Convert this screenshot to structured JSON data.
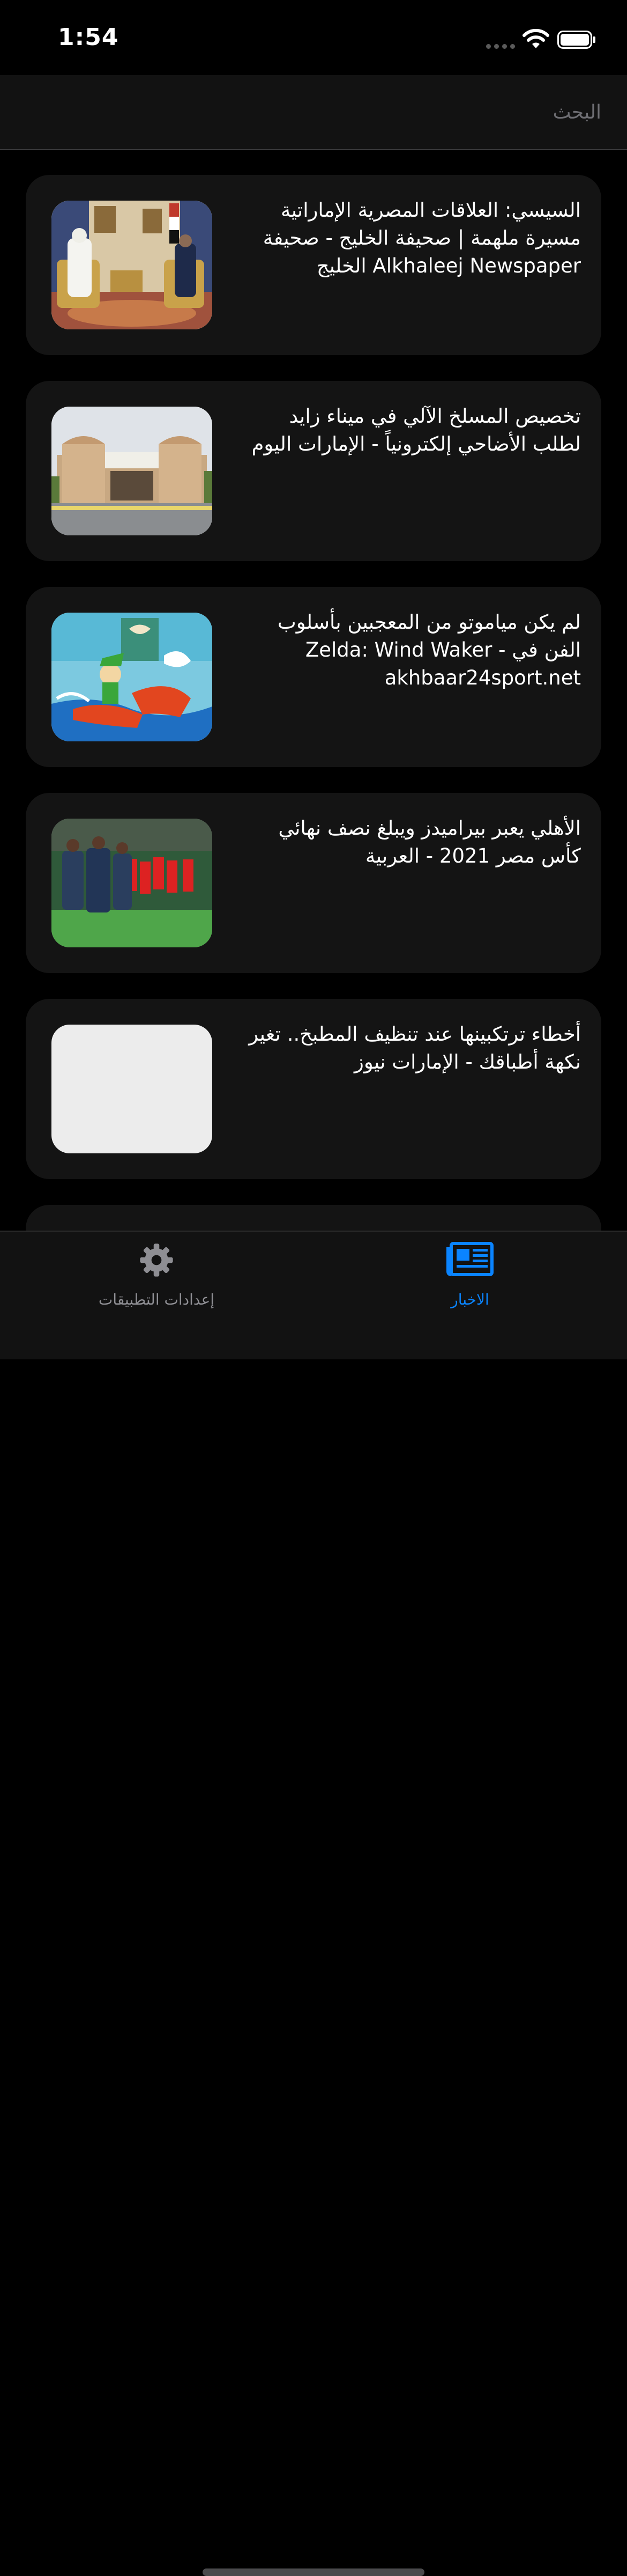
{
  "status_bar": {
    "time": "1:54",
    "wifi_icon": "wifi-icon",
    "battery_icon": "battery-full-icon"
  },
  "search": {
    "placeholder": "البحث",
    "value": ""
  },
  "news": [
    {
      "title": "السيسي: العلاقات المصرية الإماراتية مسيرة ملهمة | صحيفة الخليج - صحيفة Alkhaleej Newspaper الخليج",
      "image": "meeting-photo"
    },
    {
      "title": "تخصيص المسلخ الآلي في ميناء زايد لطلب الأضاحي إلكترونياً - الإمارات اليوم",
      "image": "building-gate-photo"
    },
    {
      "title": "لم يكن مياموتو من المعجبين بأسلوب الفن في Zelda: Wind Waker - akhbaar24sport.net",
      "image": "zelda-artwork"
    },
    {
      "title": "الأهلي يعبر بيراميدز ويبلغ نصف نهائي كأس مصر 2021 - العربية",
      "image": "football-players-photo"
    },
    {
      "title": "أخطاء ترتكبينها عند تنظيف المطبخ.. تغير نكهة أطباقك - الإمارات نيوز",
      "image": "blank-placeholder"
    }
  ],
  "tabs": [
    {
      "label": "إعدادات التطبيقات",
      "icon": "gear-icon",
      "active": false
    },
    {
      "label": "الاخبار",
      "icon": "newspaper-icon",
      "active": true
    }
  ],
  "colors": {
    "accent": "#0a84ff",
    "background": "#000000",
    "card": "#141414",
    "inactive": "#8e8e93"
  }
}
